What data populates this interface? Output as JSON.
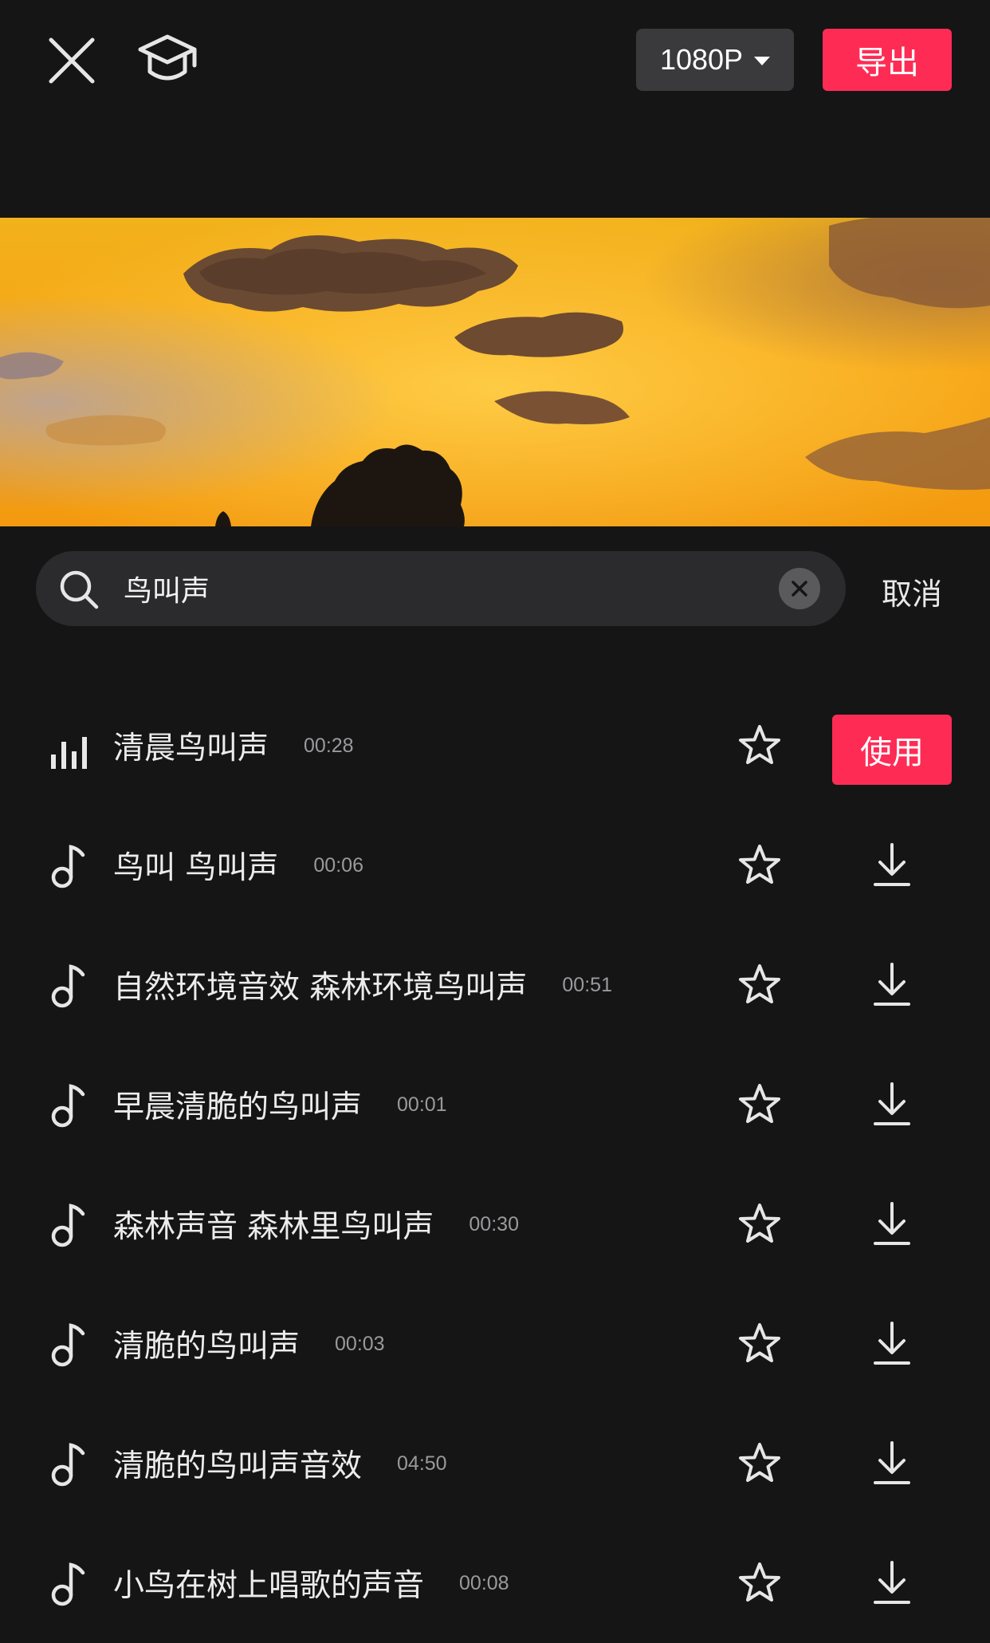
{
  "header": {
    "resolution": "1080P",
    "export_label": "导出",
    "icons": [
      "close-icon",
      "graduation-cap-icon",
      "caret-down-icon"
    ]
  },
  "search": {
    "query": "鸟叫声",
    "cancel_label": "取消",
    "icons": [
      "search-icon",
      "clear-icon"
    ]
  },
  "colors": {
    "background": "#151516",
    "accent": "#fe2c55",
    "text": "#e8e8e8",
    "muted": "#9a9a9c"
  },
  "results": [
    {
      "title": "清晨鸟叫声",
      "duration": "00:28",
      "playing": true,
      "action": "使用"
    },
    {
      "title": "鸟叫 鸟叫声",
      "duration": "00:06"
    },
    {
      "title": "自然环境音效 森林环境鸟叫声",
      "duration": "00:51"
    },
    {
      "title": "早晨清脆的鸟叫声",
      "duration": "00:01"
    },
    {
      "title": "森林声音 森林里鸟叫声",
      "duration": "00:30"
    },
    {
      "title": "清脆的鸟叫声",
      "duration": "00:03"
    },
    {
      "title": "清脆的鸟叫声音效",
      "duration": "04:50"
    },
    {
      "title": "小鸟在树上唱歌的声音",
      "duration": "00:08"
    }
  ]
}
